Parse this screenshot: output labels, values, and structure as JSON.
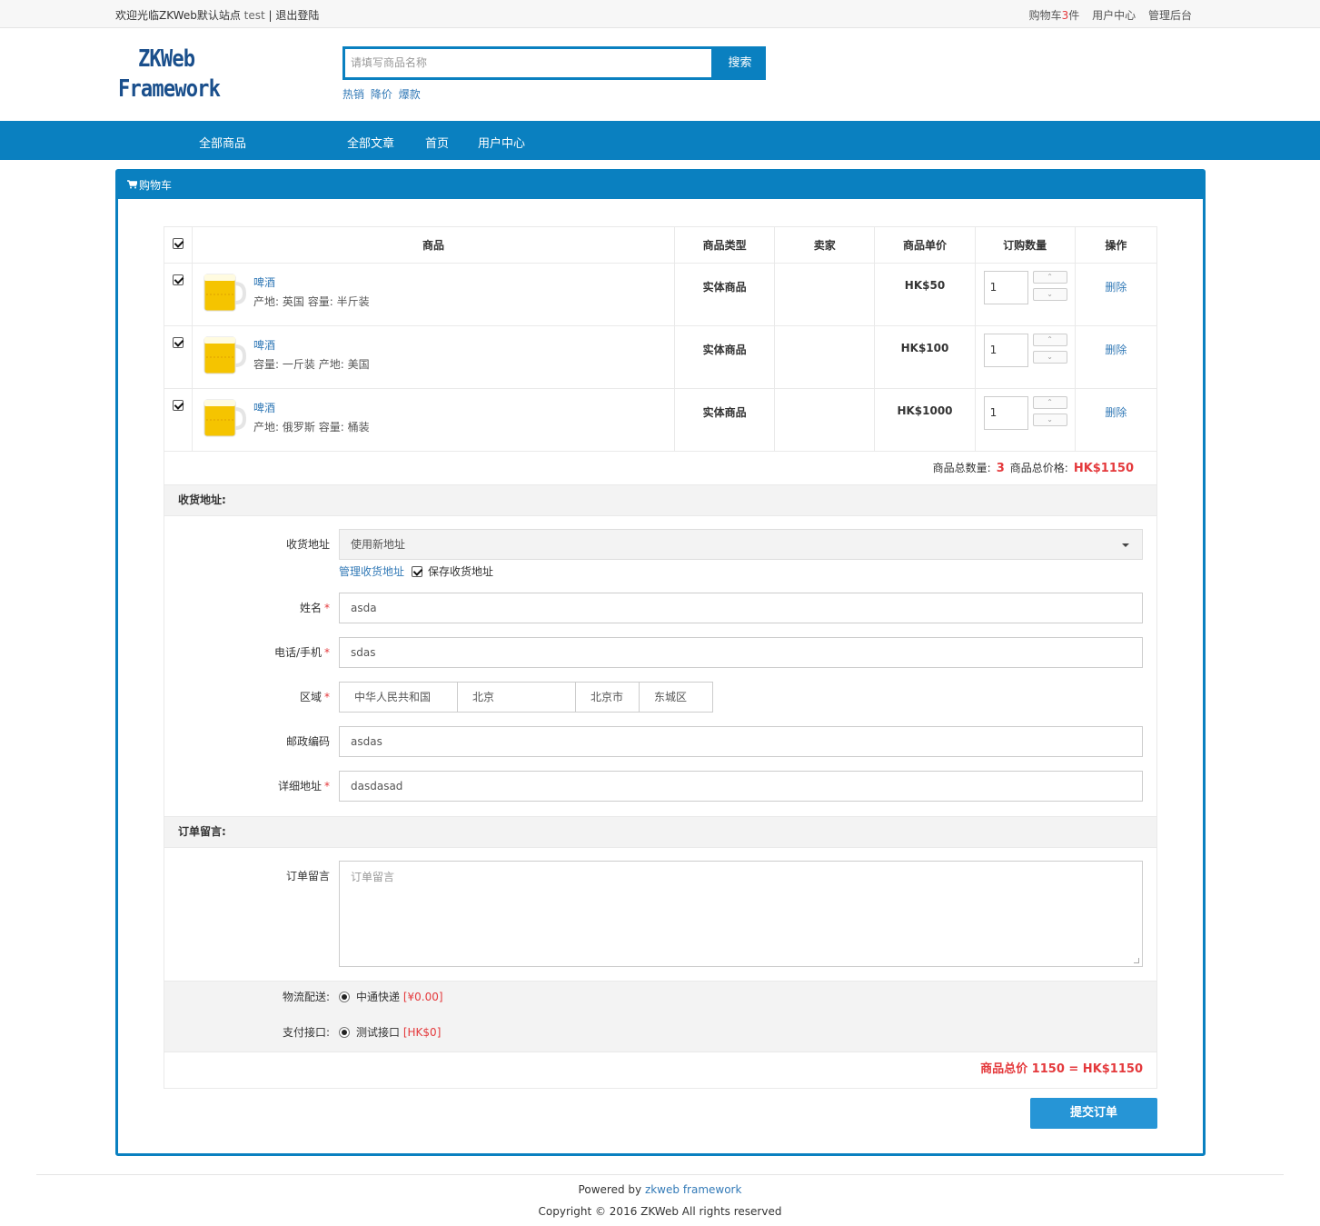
{
  "topbar": {
    "welcome": "欢迎光临ZKWeb默认站点",
    "user": "test",
    "separator": "|",
    "logout": "退出登陆",
    "cart_label": "购物车",
    "cart_count": "3",
    "cart_unit": "件",
    "user_center": "用户中心",
    "admin": "管理后台"
  },
  "header": {
    "logo_line1": "ZKWeb",
    "logo_line2": "Framework",
    "search_placeholder": "请填写商品名称",
    "search_button": "搜索",
    "hotwords": [
      "热销",
      "降价",
      "爆款"
    ]
  },
  "nav": {
    "items": [
      "全部商品",
      "全部文章",
      "首页",
      "用户中心"
    ]
  },
  "panel": {
    "title": "购物车"
  },
  "cart": {
    "headers": [
      "商品",
      "商品类型",
      "卖家",
      "商品单价",
      "订购数量",
      "操作"
    ],
    "items": [
      {
        "name": "啤酒",
        "props": "产地: 英国 容量: 半斤装",
        "type": "实体商品",
        "seller": "",
        "price": "HK$50",
        "qty": "1",
        "action": "删除"
      },
      {
        "name": "啤酒",
        "props": "容量: 一斤装 产地: 美国",
        "type": "实体商品",
        "seller": "",
        "price": "HK$100",
        "qty": "1",
        "action": "删除"
      },
      {
        "name": "啤酒",
        "props": "产地: 俄罗斯 容量: 桶装",
        "type": "实体商品",
        "seller": "",
        "price": "HK$1000",
        "qty": "1",
        "action": "删除"
      }
    ],
    "total_count_label": "商品总数量:",
    "total_count": "3",
    "total_price_label": "商品总价格:",
    "total_price": "HK$1150"
  },
  "address": {
    "section_title": "收货地址:",
    "select_label": "收货地址",
    "select_value": "使用新地址",
    "manage_link": "管理收货地址",
    "save_label": "保存收货地址",
    "name_label": "姓名",
    "name_value": "asda",
    "phone_label": "电话/手机",
    "phone_value": "sdas",
    "region_label": "区域",
    "region": [
      "中华人民共和国",
      "北京",
      "北京市",
      "东城区"
    ],
    "zip_label": "邮政编码",
    "zip_value": "asdas",
    "detail_label": "详细地址",
    "detail_value": "dasdasad",
    "required_mark": "*"
  },
  "comment": {
    "section_title": "订单留言:",
    "label": "订单留言",
    "placeholder": "订单留言"
  },
  "shipping": {
    "logistics_label": "物流配送:",
    "logistics_name": "中通快递",
    "logistics_price": "[¥0.00]",
    "payment_label": "支付接口:",
    "payment_name": "测试接口",
    "payment_price": "[HK$0]"
  },
  "grand_total": "商品总价 1150 = HK$1150",
  "submit_button": "提交订单",
  "footer": {
    "powered_by": "Powered by",
    "framework_link": "zkweb framework",
    "copyright": "Copyright © 2016 ZKWeb All rights reserved"
  },
  "colors": {
    "primary": "#0a80c0",
    "button": "#2695d6",
    "price_red": "#e4393c",
    "link": "#337ab7"
  }
}
